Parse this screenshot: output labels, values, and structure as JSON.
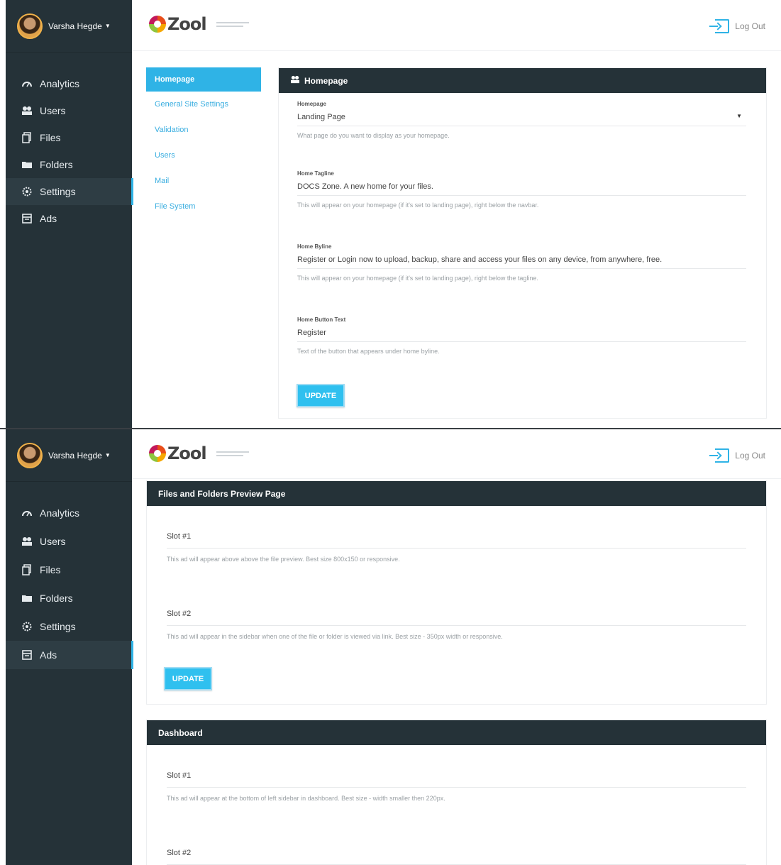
{
  "user": {
    "name": "Varsha Hegde"
  },
  "logo": {
    "text": "Zool"
  },
  "header": {
    "logout_label": "Log Out"
  },
  "nav": [
    {
      "label": "Analytics",
      "icon": "gauge-icon"
    },
    {
      "label": "Users",
      "icon": "users-icon"
    },
    {
      "label": "Files",
      "icon": "files-icon"
    },
    {
      "label": "Folders",
      "icon": "folder-icon"
    },
    {
      "label": "Settings",
      "icon": "gear-icon"
    },
    {
      "label": "Ads",
      "icon": "ads-icon"
    }
  ],
  "settings_menu": [
    "Homepage",
    "General Site Settings",
    "Validation",
    "Users",
    "Mail",
    "File System"
  ],
  "homepage_panel": {
    "title": "Homepage",
    "fields": [
      {
        "label": "Homepage",
        "value": "Landing Page",
        "help": "What page do you want to display as your homepage."
      },
      {
        "label": "Home Tagline",
        "value": "DOCS Zone. A new home for your files.",
        "help": "This will appear on your homepage (if it's set to landing page), right below the navbar."
      },
      {
        "label": "Home Byline",
        "value": "Register or Login now to upload, backup, share and access your files on any device, from anywhere, free.",
        "help": "This will appear on your homepage (if it's set to landing page), right below the tagline."
      },
      {
        "label": "Home Button Text",
        "value": "Register",
        "help": "Text of the button that appears under home byline."
      }
    ],
    "update_label": "UPDATE"
  },
  "preview_panel": {
    "title": "Files and Folders Preview Page",
    "slots": [
      {
        "label": "Slot #1",
        "help": "This ad will appear above above the file preview. Best size 800x150 or responsive."
      },
      {
        "label": "Slot #2",
        "help": "This ad will appear in the sidebar when one of the file or folder is viewed via link. Best size - 350px width or responsive."
      }
    ],
    "update_label": "UPDATE"
  },
  "dashboard_panel": {
    "title": "Dashboard",
    "slots": [
      {
        "label": "Slot #1",
        "help": "This ad will appear at the bottom of left sidebar in dashboard. Best size - width smaller then 220px."
      },
      {
        "label": "Slot #2",
        "help": ""
      }
    ]
  },
  "colors": {
    "sidebar": "#253238",
    "accent": "#2fb3e6",
    "button": "#2fc0ef"
  }
}
